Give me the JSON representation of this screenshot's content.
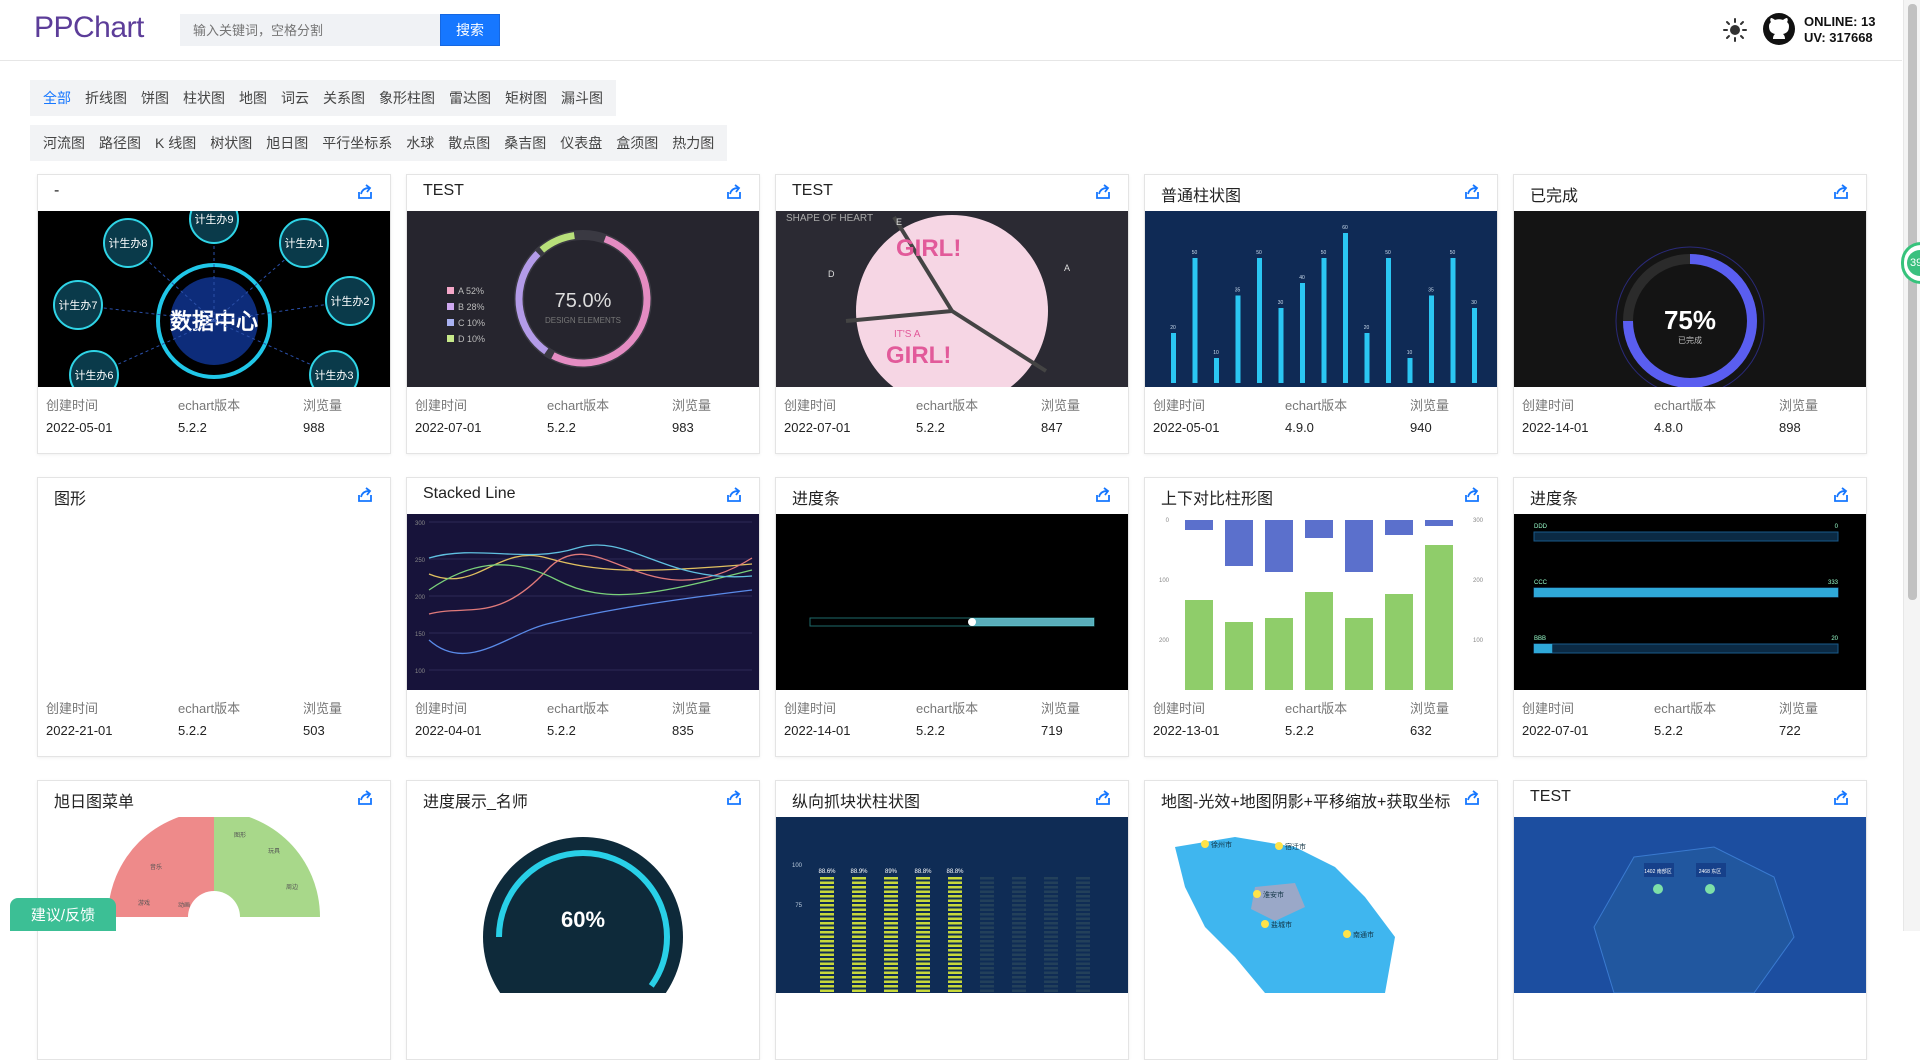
{
  "header": {
    "logo": "PPChart",
    "search_placeholder": "输入关键词，空格分割",
    "search_button": "搜索",
    "online": "ONLINE: 13",
    "uv": "UV: 317668"
  },
  "tabs_row1": [
    "全部",
    "折线图",
    "饼图",
    "柱状图",
    "地图",
    "词云",
    "关系图",
    "象形柱图",
    "雷达图",
    "矩树图",
    "漏斗图"
  ],
  "tabs_row2": [
    "河流图",
    "路径图",
    "K 线图",
    "树状图",
    "旭日图",
    "平行坐标系",
    "水球",
    "散点图",
    "桑吉图",
    "仪表盘",
    "盒须图",
    "热力图"
  ],
  "meta_labels": {
    "created": "创建时间",
    "version": "echart版本",
    "views": "浏览量"
  },
  "cards": [
    {
      "title": "-",
      "created": "2022-05-01",
      "version": "5.2.2",
      "views": "988"
    },
    {
      "title": "TEST",
      "created": "2022-07-01",
      "version": "5.2.2",
      "views": "983"
    },
    {
      "title": "TEST",
      "created": "2022-07-01",
      "version": "5.2.2",
      "views": "847"
    },
    {
      "title": "普通柱状图",
      "created": "2022-05-01",
      "version": "4.9.0",
      "views": "940"
    },
    {
      "title": "已完成",
      "created": "2022-14-01",
      "version": "4.8.0",
      "views": "898"
    },
    {
      "title": "图形",
      "created": "2022-21-01",
      "version": "5.2.2",
      "views": "503"
    },
    {
      "title": "Stacked Line",
      "created": "2022-04-01",
      "version": "5.2.2",
      "views": "835"
    },
    {
      "title": "进度条",
      "created": "2022-14-01",
      "version": "5.2.2",
      "views": "719"
    },
    {
      "title": "上下对比柱形图",
      "created": "2022-13-01",
      "version": "5.2.2",
      "views": "632"
    },
    {
      "title": "进度条",
      "created": "2022-07-01",
      "version": "5.2.2",
      "views": "722"
    },
    {
      "title": "旭日图菜单",
      "created": "",
      "version": "",
      "views": ""
    },
    {
      "title": "进度展示_名师",
      "created": "",
      "version": "",
      "views": ""
    },
    {
      "title": "纵向抓块状柱状图",
      "created": "",
      "version": "",
      "views": ""
    },
    {
      "title": "地图-光效+地图阴影+平移缩放+获取坐标",
      "created": "",
      "version": "",
      "views": ""
    },
    {
      "title": "TEST",
      "created": "",
      "version": "",
      "views": ""
    }
  ],
  "thumbs": {
    "datacenter": {
      "center": "数据中心",
      "nodes": [
        "计生办9",
        "计生办1",
        "计生办2",
        "计生办3",
        "计生办6",
        "计生办7",
        "计生办8"
      ]
    },
    "ring": {
      "value": "75.0%",
      "sub": "DESIGN ELEMENTS",
      "legend": [
        "A  52%",
        "B  28%",
        "C  10%",
        "D  10%"
      ]
    },
    "heart": {
      "title": "SHAPE OF HEART",
      "text1": "GIRL!",
      "text2": "IT'S A",
      "labels": [
        "E",
        "D",
        "A"
      ]
    },
    "bars": {
      "values": [
        20,
        50,
        10,
        35,
        50,
        30,
        40,
        50,
        60,
        20,
        50,
        10,
        35,
        50,
        30
      ],
      "labels": [
        "20",
        "50",
        "10",
        "35",
        "50",
        "30",
        "40",
        "50",
        "60",
        "20",
        "50",
        "10",
        "35",
        "50",
        "30"
      ]
    },
    "gauge": {
      "value": "75%",
      "sub": "已完成"
    },
    "stacked": {
      "yticks": [
        "300",
        "250",
        "200",
        "150",
        "100"
      ]
    },
    "compare": {
      "lticks": [
        "0",
        "100",
        "200"
      ],
      "rticks": [
        "300",
        "200",
        "100"
      ]
    },
    "progress": {
      "rows": [
        {
          "name": "DDD",
          "value": "0"
        },
        {
          "name": "CCC",
          "value": "333"
        },
        {
          "name": "BBB",
          "value": "20"
        }
      ]
    },
    "sunburst": {
      "labels": [
        "图形",
        "玩具",
        "周边",
        "音乐",
        "游戏",
        "动画"
      ]
    },
    "pie60": {
      "value": "60%"
    },
    "vbars": {
      "labels": [
        "88.6%",
        "88.9%",
        "89%",
        "88.8%",
        "88.8%"
      ],
      "yticks": [
        "100",
        "75"
      ]
    },
    "map": {
      "labels": [
        "徐州市",
        "宿迁市",
        "淮安市",
        "盐城市",
        "南通市"
      ]
    },
    "bluemap": {
      "labels": [
        "1402 南部区",
        "2468 东区"
      ]
    }
  },
  "feedback": "建议/反馈",
  "side_badge": "39"
}
